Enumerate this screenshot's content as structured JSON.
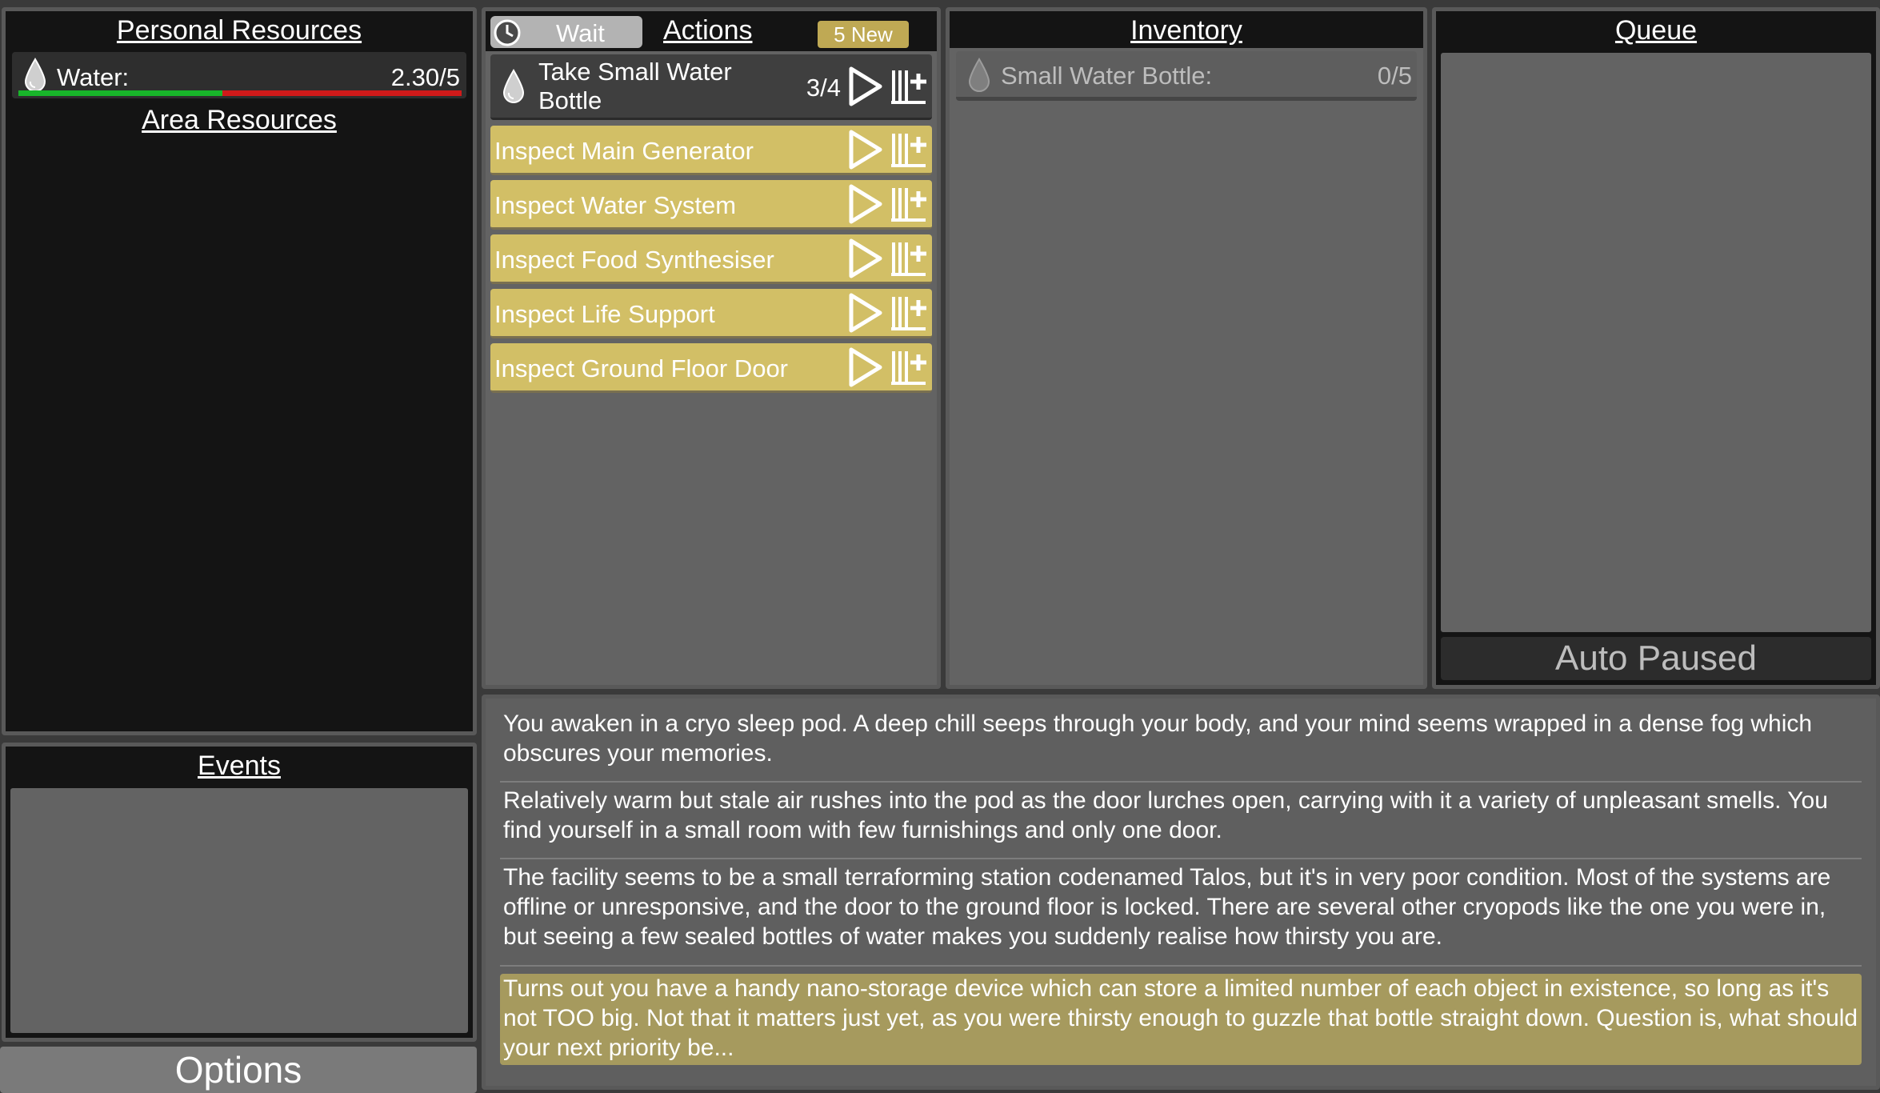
{
  "personal_resources": {
    "title": "Personal Resources",
    "items": [
      {
        "label": "Water:",
        "value": "2.30/5",
        "fill_fraction": 0.46,
        "icon": "water-drop-icon"
      }
    ]
  },
  "area_resources": {
    "title": "Area Resources"
  },
  "events": {
    "title": "Events"
  },
  "options": {
    "label": "Options"
  },
  "actions": {
    "wait_label": "Wait",
    "title": "Actions",
    "new_badge": "5 New",
    "items": [
      {
        "label": "Take Small Water Bottle",
        "count": "3/4",
        "highlight": false,
        "icon": "water-drop-icon"
      },
      {
        "label": "Inspect Main Generator",
        "highlight": true
      },
      {
        "label": "Inspect Water System",
        "highlight": true
      },
      {
        "label": "Inspect Food Synthesiser",
        "highlight": true
      },
      {
        "label": "Inspect Life Support",
        "highlight": true
      },
      {
        "label": "Inspect Ground Floor Door",
        "highlight": true
      }
    ]
  },
  "inventory": {
    "title": "Inventory",
    "items": [
      {
        "label": "Small Water Bottle:",
        "value": "0/5",
        "icon": "water-drop-icon"
      }
    ]
  },
  "queue": {
    "title": "Queue",
    "status": "Auto Paused"
  },
  "log": {
    "entries": [
      {
        "text": "You awaken in a cryo sleep pod. A deep chill seeps through your body, and your mind seems wrapped in a dense fog which obscures your memories."
      },
      {
        "text": "Relatively warm but stale air rushes into the pod as the door lurches open, carrying with it a variety of unpleasant smells. You find yourself in a small room with few furnishings and only one door."
      },
      {
        "text": "The facility seems to be a small terraforming station codenamed Talos, but it's in very poor condition. Most of the systems are offline or unresponsive, and the door to the ground floor is locked. There are several other cryopods like the one you were in, but seeing a few sealed bottles of water makes you suddenly realise how thirsty you are."
      },
      {
        "text": "Turns out you have a handy nano-storage device which can store a limited number of each object in existence, so long as it's not TOO big. Not that it matters just yet, as you were thirsty enough to guzzle that bottle straight down. Question is, what should your next priority be...",
        "highlight": true
      }
    ]
  },
  "colors": {
    "action_highlight": "#d2bf66",
    "bar_good": "#18b52a",
    "bar_bad": "#d01a1a",
    "log_highlight": "#a69a5e"
  }
}
